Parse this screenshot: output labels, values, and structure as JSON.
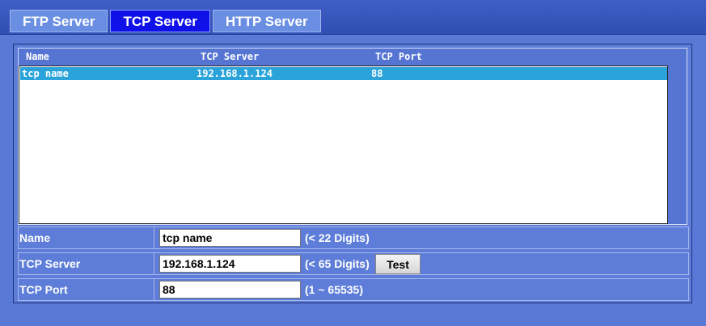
{
  "tabs": [
    {
      "label": "FTP Server",
      "active": false
    },
    {
      "label": "TCP Server",
      "active": true
    },
    {
      "label": "HTTP Server",
      "active": false
    }
  ],
  "list": {
    "columns": [
      "Name",
      "TCP Server",
      "TCP Port"
    ],
    "rows": [
      {
        "name": "tcp name",
        "server": "192.168.1.124",
        "port": "88",
        "selected": true
      }
    ]
  },
  "form": {
    "name": {
      "label": "Name",
      "value": "tcp name",
      "hint": "(< 22 Digits)"
    },
    "server": {
      "label": "TCP Server",
      "value": "192.168.1.124",
      "hint": "(< 65 Digits)",
      "test_label": "Test"
    },
    "port": {
      "label": "TCP Port",
      "value": "88",
      "hint": "(1 ~ 65535)"
    }
  },
  "colors": {
    "background": "#5a78d6",
    "active_tab": "#1010e8",
    "inactive_tab": "#6a8ee2",
    "selected_row": "#2aa3da"
  }
}
